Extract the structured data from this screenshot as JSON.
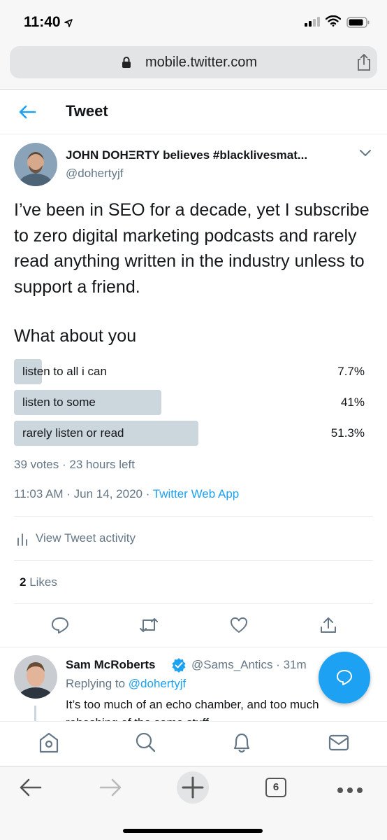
{
  "status_bar": {
    "time": "11:40"
  },
  "browser": {
    "url": "mobile.twitter.com",
    "tabs_count": "6"
  },
  "header": {
    "title": "Tweet"
  },
  "tweet": {
    "author_name": "JOHN DOHΞRTY believes #blacklivesmat...",
    "author_handle": "@dohertyjf",
    "text": "I’ve been in SEO for a decade, yet I subscribe to zero digital marketing podcasts and rarely read anything written in the industry unless to support a friend.",
    "poll": {
      "question": "What about you",
      "options": [
        {
          "label": "listen to all i can",
          "percent_text": "7.7%",
          "percent": 7.7
        },
        {
          "label": "listen to some",
          "percent_text": "41%",
          "percent": 41
        },
        {
          "label": "rarely listen or read",
          "percent_text": "51.3%",
          "percent": 51.3
        }
      ],
      "meta": "39 votes · 23 hours left"
    },
    "time": "11:03 AM · Jun 14, 2020 · ",
    "source": "Twitter Web App",
    "activity_label": "View Tweet activity",
    "likes_count": "2",
    "likes_label": " Likes"
  },
  "reply": {
    "name": "Sam McRoberts",
    "handle_time": "@Sams_Antics · 31m",
    "replying_prefix": "Replying to ",
    "replying_handle": "@dohertyjf",
    "text": "It’s too much of an echo chamber, and too much rehashing of the same stuff"
  },
  "colors": {
    "accent": "#1da1f2",
    "poll_bar": "#ccd6dd",
    "secondary_text": "#657786"
  },
  "icons": [
    "location-arrow-icon",
    "signal-icon",
    "wifi-icon",
    "battery-icon",
    "lock-icon",
    "share-icon",
    "back-arrow-icon",
    "chevron-down-icon",
    "activity-chart-icon",
    "reply-icon",
    "retweet-icon",
    "like-icon",
    "share-tweet-icon",
    "verified-icon",
    "compose-icon",
    "home-icon",
    "search-icon",
    "notifications-icon",
    "messages-icon",
    "safari-back-icon",
    "safari-forward-icon",
    "new-tab-icon",
    "tabs-icon",
    "more-icon"
  ]
}
